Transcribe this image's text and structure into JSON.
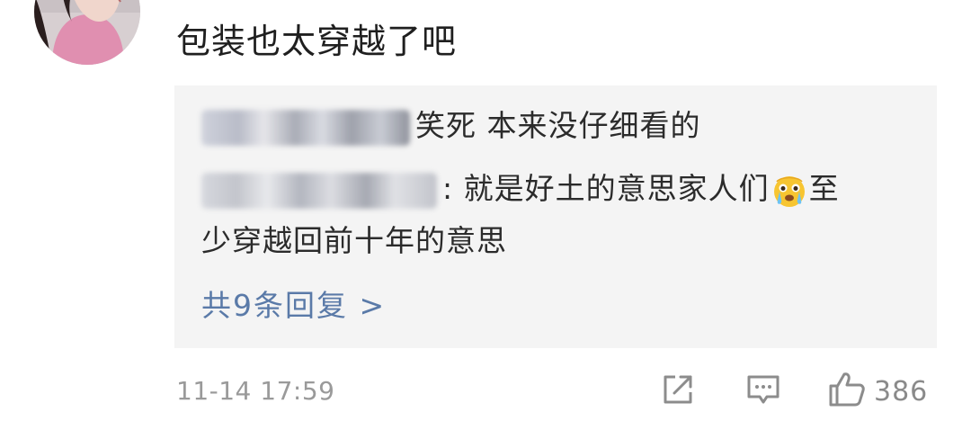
{
  "comment": {
    "text": "包装也太穿越了吧",
    "avatar_icon": "user-avatar"
  },
  "replies": {
    "reply1": {
      "text": "笑死   本来没仔细看的"
    },
    "reply2": {
      "text_before_emoji": ": 就是好土的意思家人们",
      "emoji_icon": "crying-emoji",
      "text_after_emoji": "至",
      "continuation": "少穿越回前十年的意思"
    },
    "more_label": "共9条回复 >"
  },
  "footer": {
    "timestamp": "11-14 17:59",
    "share_icon": "share-icon",
    "reply_icon": "comment-icon",
    "like_icon": "thumbs-up-icon",
    "like_count": "386"
  },
  "colors": {
    "link_blue": "#5a7aa8",
    "reply_bg": "#f4f4f4",
    "meta_gray": "#9a9a9a"
  }
}
